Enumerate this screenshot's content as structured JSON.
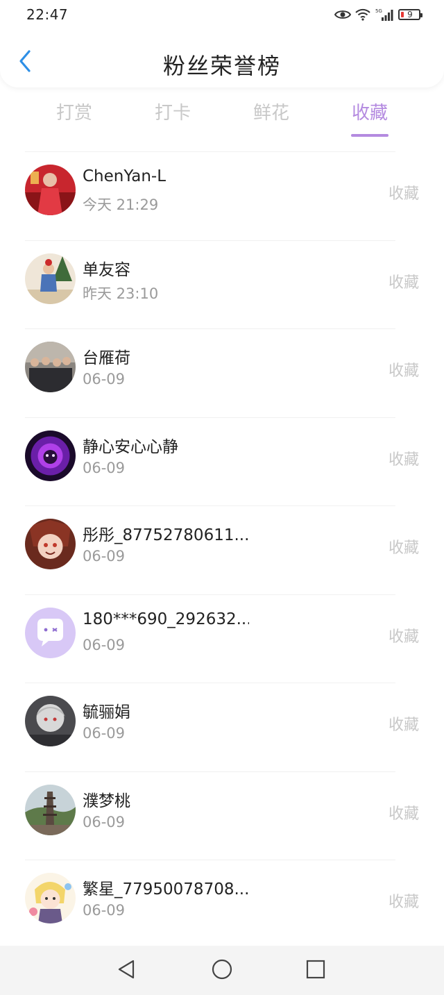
{
  "status_bar": {
    "time": "22:47",
    "battery": "9",
    "network": "5G"
  },
  "header": {
    "title": "粉丝荣誉榜",
    "back_icon": "chevron-left-icon"
  },
  "tabs": [
    {
      "label": "打赏",
      "active": false
    },
    {
      "label": "打卡",
      "active": false
    },
    {
      "label": "鲜花",
      "active": false
    },
    {
      "label": "收藏",
      "active": true
    }
  ],
  "fans": [
    {
      "name": "ChenYan-L",
      "time": "今天 21:29",
      "action": "收藏"
    },
    {
      "name": "单友容",
      "time": "昨天 23:10",
      "action": "收藏"
    },
    {
      "name": "台雁荷",
      "time": "06-09",
      "action": "收藏"
    },
    {
      "name": "静心安心心静",
      "time": "06-09",
      "action": "收藏"
    },
    {
      "name": "彤彤_87752780611...",
      "time": "06-09",
      "action": "收藏"
    },
    {
      "name": "180***690_292632...",
      "time": "06-09",
      "action": "收藏"
    },
    {
      "name": "毓骊娟",
      "time": "06-09",
      "action": "收藏"
    },
    {
      "name": "濮梦桃",
      "time": "06-09",
      "action": "收藏"
    },
    {
      "name": "繁星_77950078708...",
      "time": "06-09",
      "action": "收藏"
    }
  ],
  "colors": {
    "accent": "#b48ae0",
    "muted": "#c8c8c8",
    "subtext": "#9a9a9a"
  },
  "system_nav": {
    "back_icon": "triangle-back-icon",
    "home_icon": "circle-home-icon",
    "recents_icon": "square-recents-icon"
  }
}
